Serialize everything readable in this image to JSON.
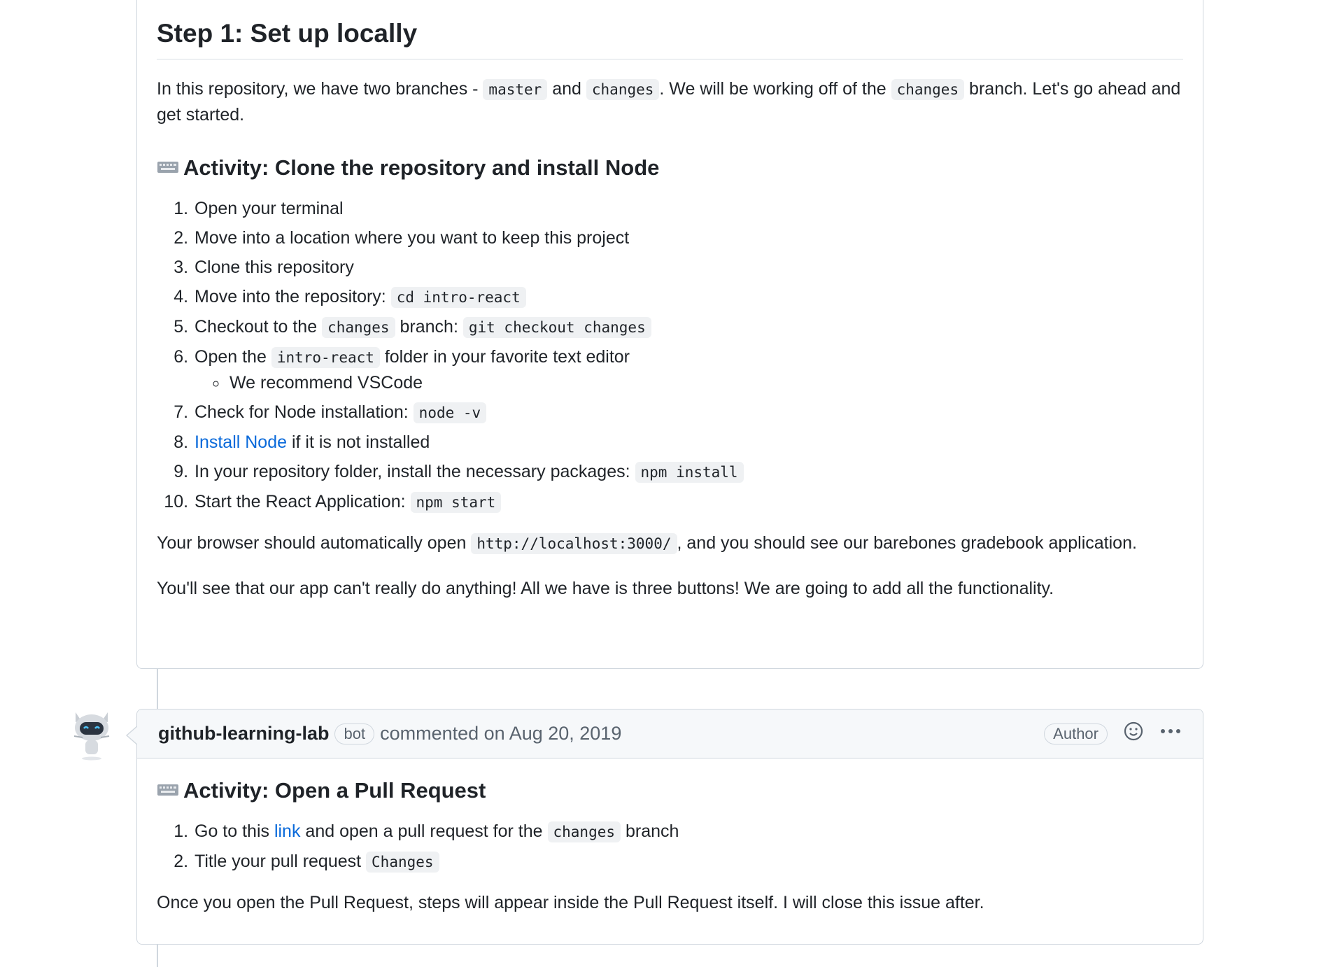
{
  "step": {
    "title": "Step 1: Set up locally",
    "intro_1": "In this repository, we have two branches - ",
    "code_master": "master",
    "intro_2": " and ",
    "code_changes": "changes",
    "intro_3": ". We will be working off of the ",
    "intro_4": " branch. Let's go ahead and get started."
  },
  "activity1": {
    "icon": "keyboard-icon",
    "title": "Activity: Clone the repository and install Node",
    "items": [
      "Open your terminal",
      "Move into a location where you want to keep this project",
      "Clone this repository",
      "Move into the repository: ",
      "Checkout to the ",
      "Open the ",
      "Check for Node installation: ",
      "Install Node",
      "In your repository folder, install the necessary packages: ",
      "Start the React Application: "
    ],
    "item4_code": "cd intro-react",
    "item5_code1": "changes",
    "item5_mid": " branch: ",
    "item5_code2": "git checkout changes",
    "item6_code": "intro-react",
    "item6_rest": " folder in your favorite text editor",
    "item6_sub": "We recommend VSCode",
    "item7_code": "node -v",
    "item8_rest": " if it is not installed",
    "item9_code": "npm install",
    "item10_code": "npm start",
    "outro_1": "Your browser should automatically open ",
    "outro_code": "http://localhost:3000/",
    "outro_2": ", and you should see our barebones gradebook application.",
    "outro_3": "You'll see that our app can't really do anything! All we have is three buttons! We are going to add all the functionality."
  },
  "comment": {
    "author": "github-learning-lab",
    "bot_label": "bot",
    "meta": "commented on Aug 20, 2019",
    "author_badge": "Author",
    "activity_title": "Activity: Open a Pull Request",
    "item1_a": "Go to this ",
    "item1_link": "link",
    "item1_b": " and open a pull request for the ",
    "item1_code": "changes",
    "item1_c": " branch",
    "item2_a": "Title your pull request ",
    "item2_code": "Changes",
    "outro": "Once you open the Pull Request, steps will appear inside the Pull Request itself. I will close this issue after."
  },
  "colors": {
    "link": "#0969da",
    "border": "#d0d7de",
    "header_bg": "#f6f8fa"
  }
}
